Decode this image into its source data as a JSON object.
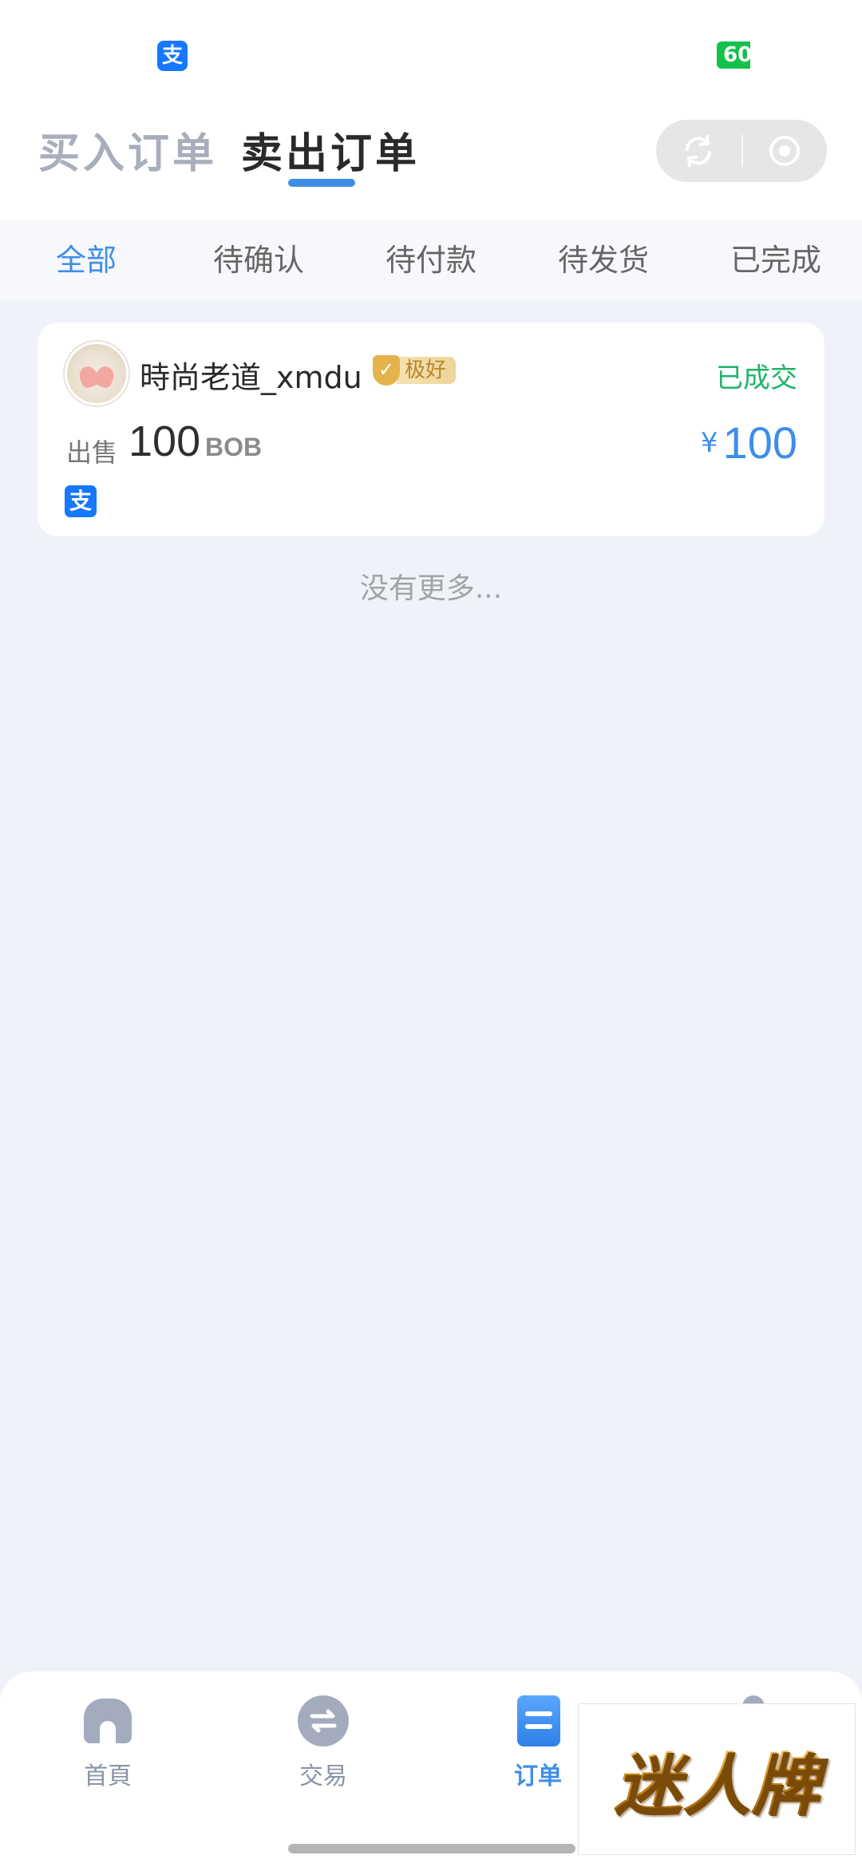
{
  "status_bar": {
    "app_icon": "alipay-icon",
    "app_icon_glyph": "支",
    "battery": "60"
  },
  "header": {
    "tabs": [
      {
        "label": "买入订单",
        "active": false
      },
      {
        "label": "卖出订单",
        "active": true
      }
    ],
    "capsule_icons": [
      "refresh-icon",
      "record-icon"
    ]
  },
  "status_tabs": [
    {
      "label": "全部",
      "active": true
    },
    {
      "label": "待确认",
      "active": false
    },
    {
      "label": "待付款",
      "active": false
    },
    {
      "label": "待发货",
      "active": false
    },
    {
      "label": "已完成",
      "active": false
    }
  ],
  "orders": [
    {
      "seller_name": "時尚老道_xmdu",
      "badge": "极好",
      "badge_glyph": "✓",
      "status": "已成交",
      "type_label": "出售",
      "amount": "100",
      "unit": "BOB",
      "price_symbol": "¥",
      "price": "100",
      "payment_icon": "alipay-icon",
      "payment_glyph": "支"
    }
  ],
  "no_more_text": "没有更多...",
  "bottom_nav": [
    {
      "label": "首頁",
      "icon": "home-icon",
      "active": false
    },
    {
      "label": "交易",
      "icon": "exchange-icon",
      "active": false
    },
    {
      "label": "订单",
      "icon": "order-icon",
      "active": true
    },
    {
      "label": "",
      "icon": "profile-icon",
      "active": false
    }
  ],
  "watermark": "迷人牌",
  "colors": {
    "accent": "#3e8ee8",
    "success": "#21b26a",
    "alipay": "#1677ff",
    "badge_gold": "#e4b34b"
  }
}
